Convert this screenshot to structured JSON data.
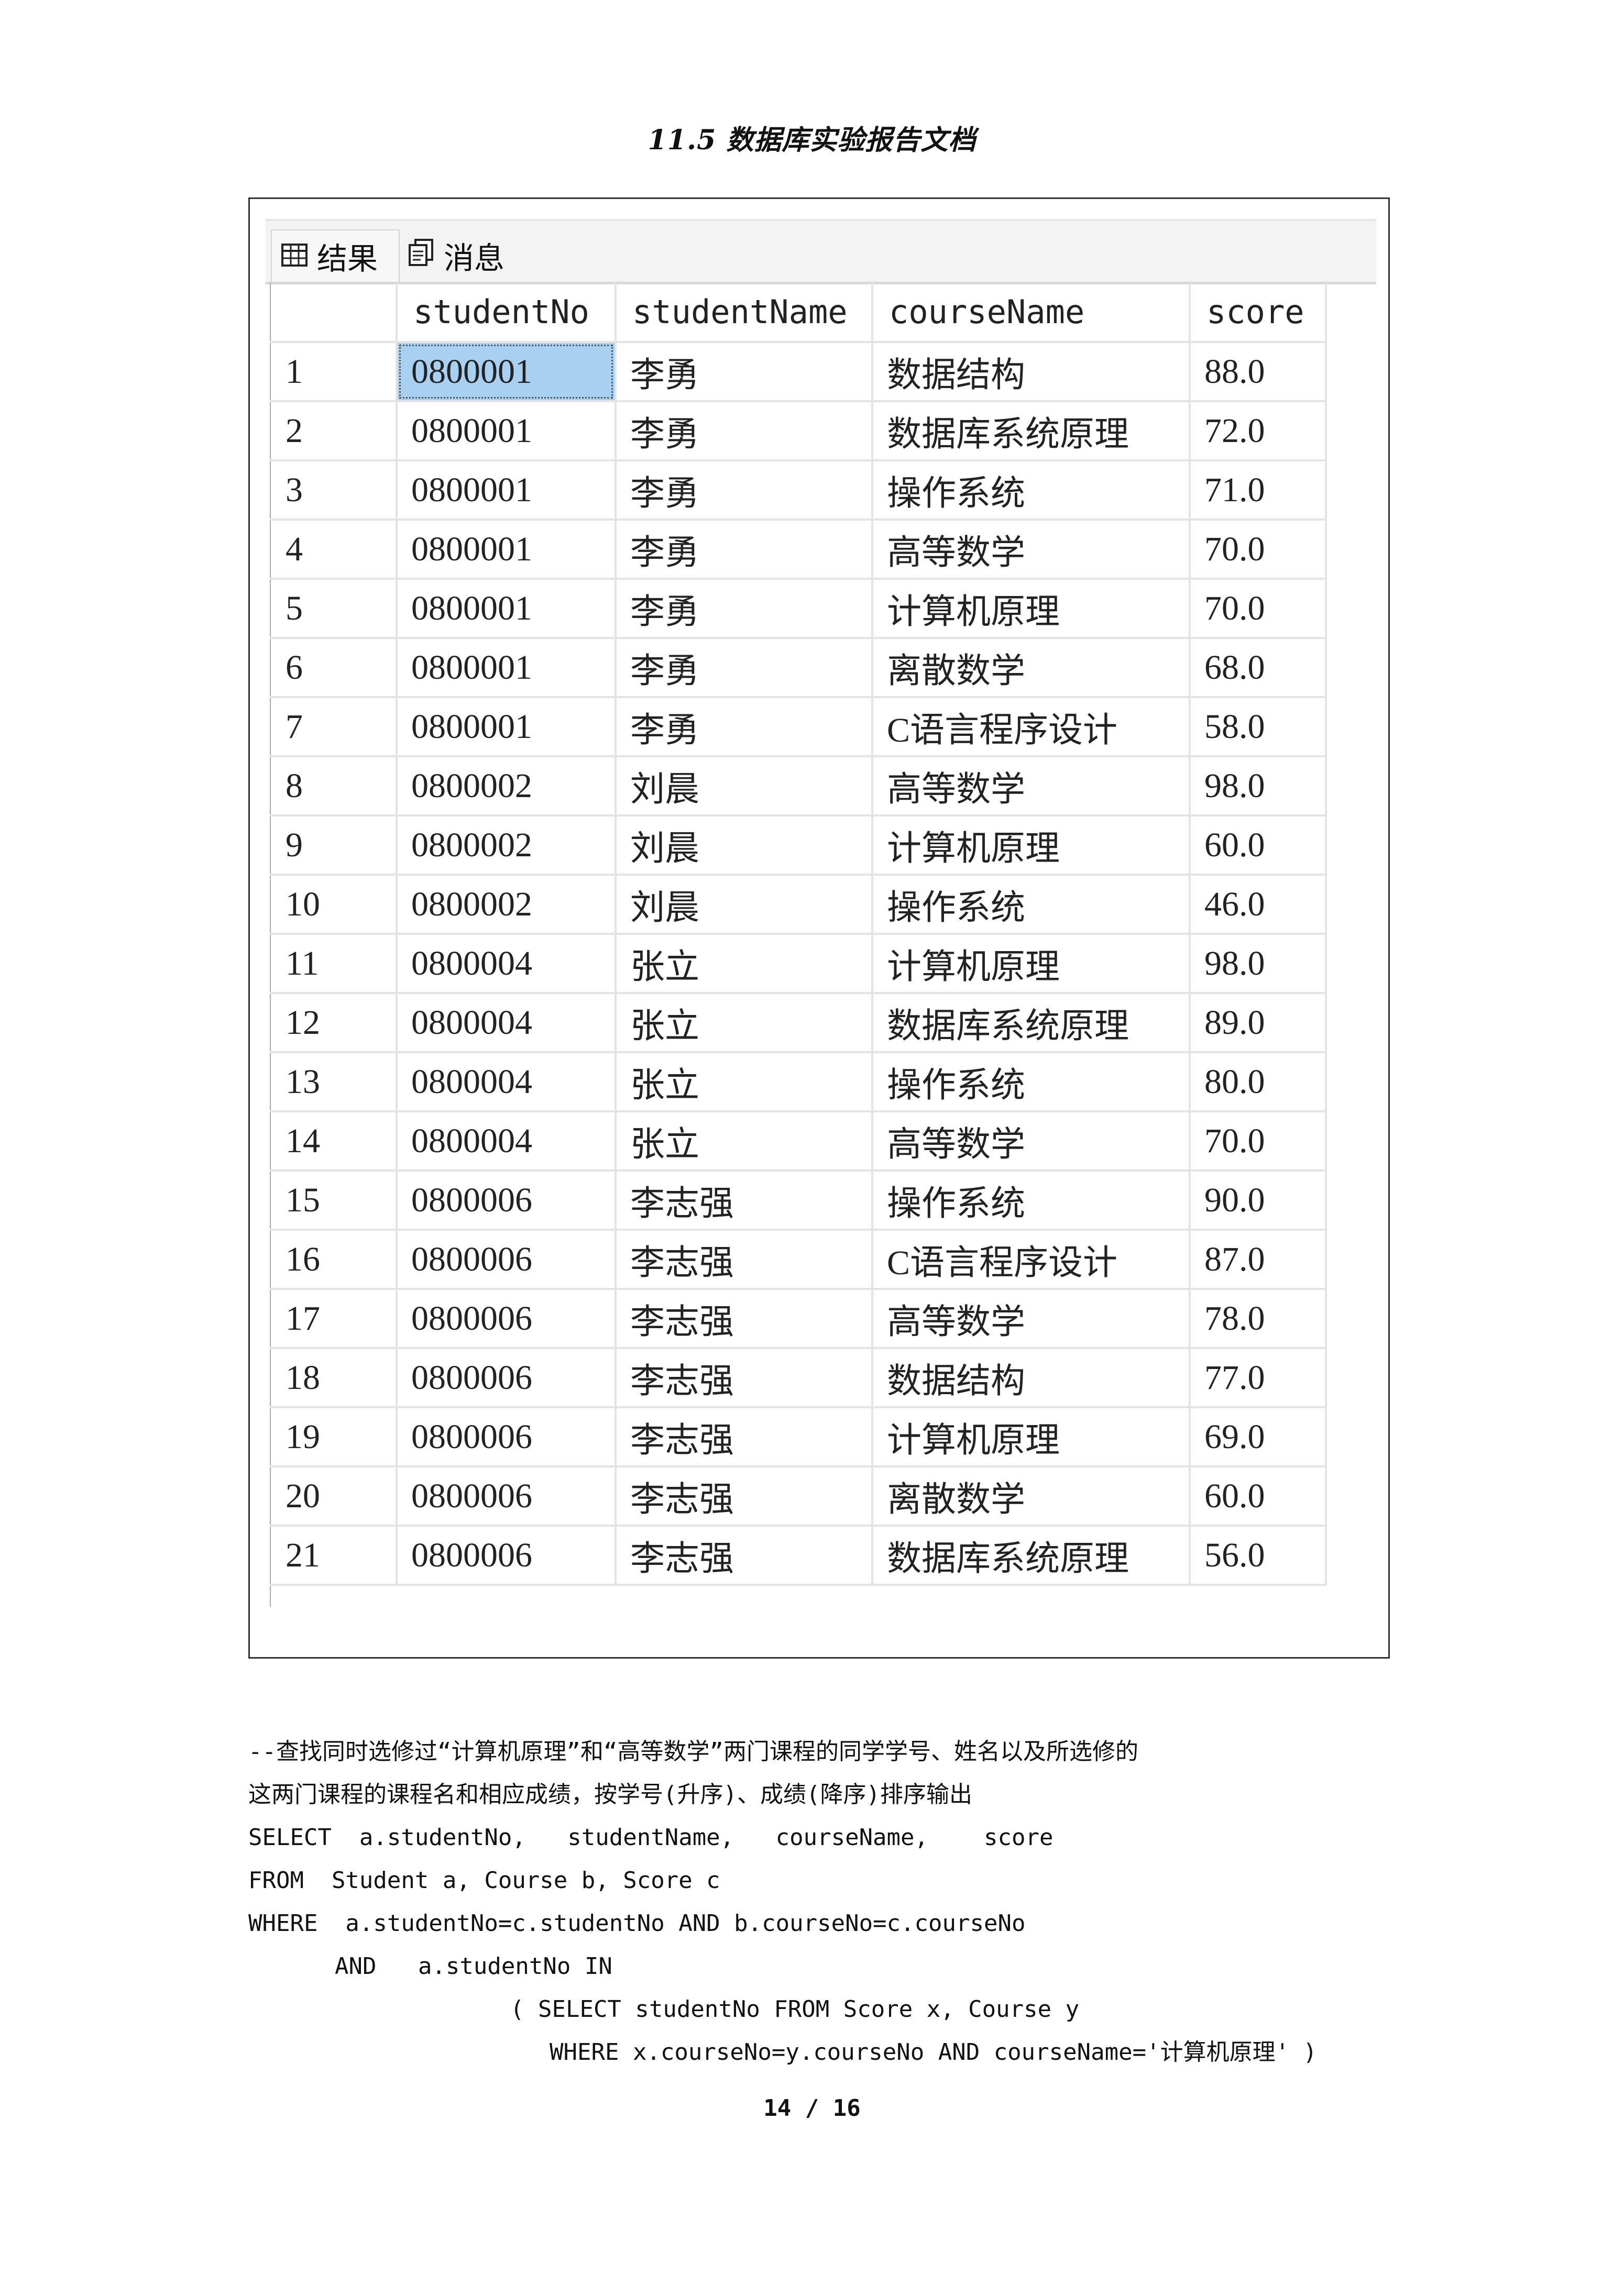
{
  "header": {
    "title": "11.5 数据库实验报告文档"
  },
  "results_window": {
    "tabs": [
      {
        "label": "结果",
        "icon": "grid-icon"
      },
      {
        "label": "消息",
        "icon": "messages-icon"
      }
    ],
    "columns": [
      "",
      "studentNo",
      "studentName",
      "courseName",
      "score"
    ],
    "rows": [
      [
        "1",
        "0800001",
        "李勇",
        "数据结构",
        "88.0"
      ],
      [
        "2",
        "0800001",
        "李勇",
        "数据库系统原理",
        "72.0"
      ],
      [
        "3",
        "0800001",
        "李勇",
        "操作系统",
        "71.0"
      ],
      [
        "4",
        "0800001",
        "李勇",
        "高等数学",
        "70.0"
      ],
      [
        "5",
        "0800001",
        "李勇",
        "计算机原理",
        "70.0"
      ],
      [
        "6",
        "0800001",
        "李勇",
        "离散数学",
        "68.0"
      ],
      [
        "7",
        "0800001",
        "李勇",
        "C语言程序设计",
        "58.0"
      ],
      [
        "8",
        "0800002",
        "刘晨",
        "高等数学",
        "98.0"
      ],
      [
        "9",
        "0800002",
        "刘晨",
        "计算机原理",
        "60.0"
      ],
      [
        "10",
        "0800002",
        "刘晨",
        "操作系统",
        "46.0"
      ],
      [
        "11",
        "0800004",
        "张立",
        "计算机原理",
        "98.0"
      ],
      [
        "12",
        "0800004",
        "张立",
        "数据库系统原理",
        "89.0"
      ],
      [
        "13",
        "0800004",
        "张立",
        "操作系统",
        "80.0"
      ],
      [
        "14",
        "0800004",
        "张立",
        "高等数学",
        "70.0"
      ],
      [
        "15",
        "0800006",
        "李志强",
        "操作系统",
        "90.0"
      ],
      [
        "16",
        "0800006",
        "李志强",
        "C语言程序设计",
        "87.0"
      ],
      [
        "17",
        "0800006",
        "李志强",
        "高等数学",
        "78.0"
      ],
      [
        "18",
        "0800006",
        "李志强",
        "数据结构",
        "77.0"
      ],
      [
        "19",
        "0800006",
        "李志强",
        "计算机原理",
        "69.0"
      ],
      [
        "20",
        "0800006",
        "李志强",
        "离散数学",
        "60.0"
      ],
      [
        "21",
        "0800006",
        "李志强",
        "数据库系统原理",
        "56.0"
      ]
    ],
    "selection_color": "#a8d0f0"
  },
  "sql": {
    "lines": [
      "--查找同时选修过“计算机原理”和“高等数学”两门课程的同学学号、姓名以及所选修的",
      "这两门课程的课程名和相应成绩，按学号(升序)、成绩(降序)排序输出",
      "SELECT  a.studentNo,   studentName,   courseName,    score",
      "FROM  Student a, Course b, Score c",
      "WHERE  a.studentNo=c.studentNo AND b.courseNo=c.courseNo",
      "AND   a.studentNo IN",
      "( SELECT studentNo FROM Score x, Course y",
      "WHERE x.courseNo=y.courseNo AND courseName='计算机原理' )"
    ]
  },
  "footer": {
    "page_number": "14 / 16"
  }
}
